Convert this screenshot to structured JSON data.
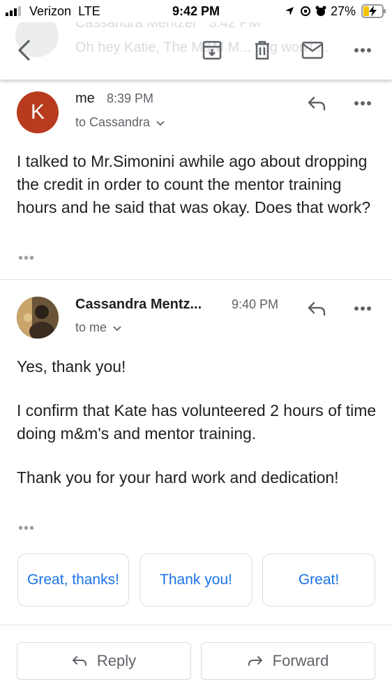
{
  "status_bar": {
    "carrier": "Verizon",
    "network": "LTE",
    "time": "9:42 PM",
    "battery": "27%"
  },
  "toolbar": {
    "ghost_sender": "Cassandra Mentzer",
    "ghost_time": "3:42 PM",
    "ghost_snippet": "Oh hey Katie, The M&M M... ting won't ...",
    "icons": [
      "back-arrow-icon",
      "archive-icon",
      "trash-icon",
      "mail-icon",
      "more-icon"
    ]
  },
  "messages": [
    {
      "sender": "me",
      "time": "8:39 PM",
      "recipients": "to Cassandra",
      "avatar_letter": "K",
      "avatar_color": "#b83b1d",
      "paragraphs": [
        "I talked to Mr.Simonini awhile ago about dropping the credit in order to count the mentor training hours and he said that was okay. Does that work?"
      ]
    },
    {
      "sender": "Cassandra Mentz...",
      "time": "9:40 PM",
      "recipients": "to me",
      "paragraphs": [
        "Yes, thank you!",
        "I confirm that Kate has volunteered 2 hours of time doing m&m's and mentor training.",
        "Thank you for your hard work and dedication!"
      ]
    }
  ],
  "smart_replies": [
    "Great, thanks!",
    "Thank you!",
    "Great!"
  ],
  "actions": {
    "reply": "Reply",
    "forward": "Forward"
  },
  "colors": {
    "accent": "#1a73e8",
    "avatar_k": "#b83b1d"
  }
}
